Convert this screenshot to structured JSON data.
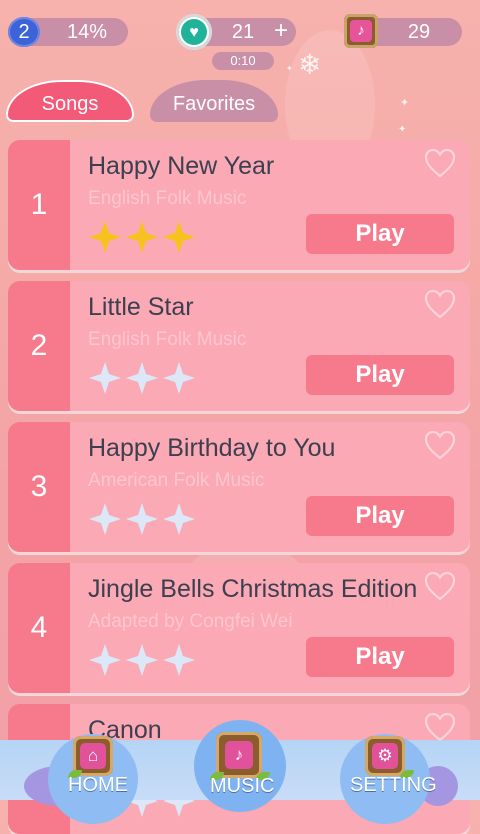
{
  "status": {
    "level": "2",
    "progress_text": "14%",
    "lives": "21",
    "lives_plus": "+",
    "timer": "0:10",
    "notes": "29"
  },
  "tabs": [
    {
      "label": "Songs",
      "active": true
    },
    {
      "label": "Favorites",
      "active": false
    }
  ],
  "songs": [
    {
      "rank": "1",
      "title": "Happy New Year",
      "artist": "English Folk Music",
      "stars": 3,
      "max_stars": 3,
      "play_label": "Play",
      "favorite": false
    },
    {
      "rank": "2",
      "title": "Little Star",
      "artist": "English Folk Music",
      "stars": 0,
      "max_stars": 3,
      "play_label": "Play",
      "favorite": false
    },
    {
      "rank": "3",
      "title": "Happy Birthday to You",
      "artist": "American Folk Music",
      "stars": 0,
      "max_stars": 3,
      "play_label": "Play",
      "favorite": false
    },
    {
      "rank": "4",
      "title": "Jingle Bells Christmas Edition",
      "artist": "Adapted by Congfei Wei",
      "stars": 0,
      "max_stars": 3,
      "play_label": "Play",
      "favorite": false
    },
    {
      "rank": "",
      "title": "Canon",
      "artist": "",
      "stars": 0,
      "max_stars": 3,
      "play_label": "",
      "favorite": false
    }
  ],
  "nav": [
    {
      "label": "HOME",
      "icon": "home-icon",
      "active": false
    },
    {
      "label": "MUSIC",
      "icon": "music-note-icon",
      "active": true
    },
    {
      "label": "SETTING",
      "icon": "gear-icon",
      "active": false
    }
  ],
  "colors": {
    "accent": "#f35a78",
    "card": "#fba9b4",
    "rank_column": "#f6798c",
    "star_filled": "#f7c21d",
    "star_empty": "#dce8f8",
    "nav_bar": "#b5d4f5"
  }
}
